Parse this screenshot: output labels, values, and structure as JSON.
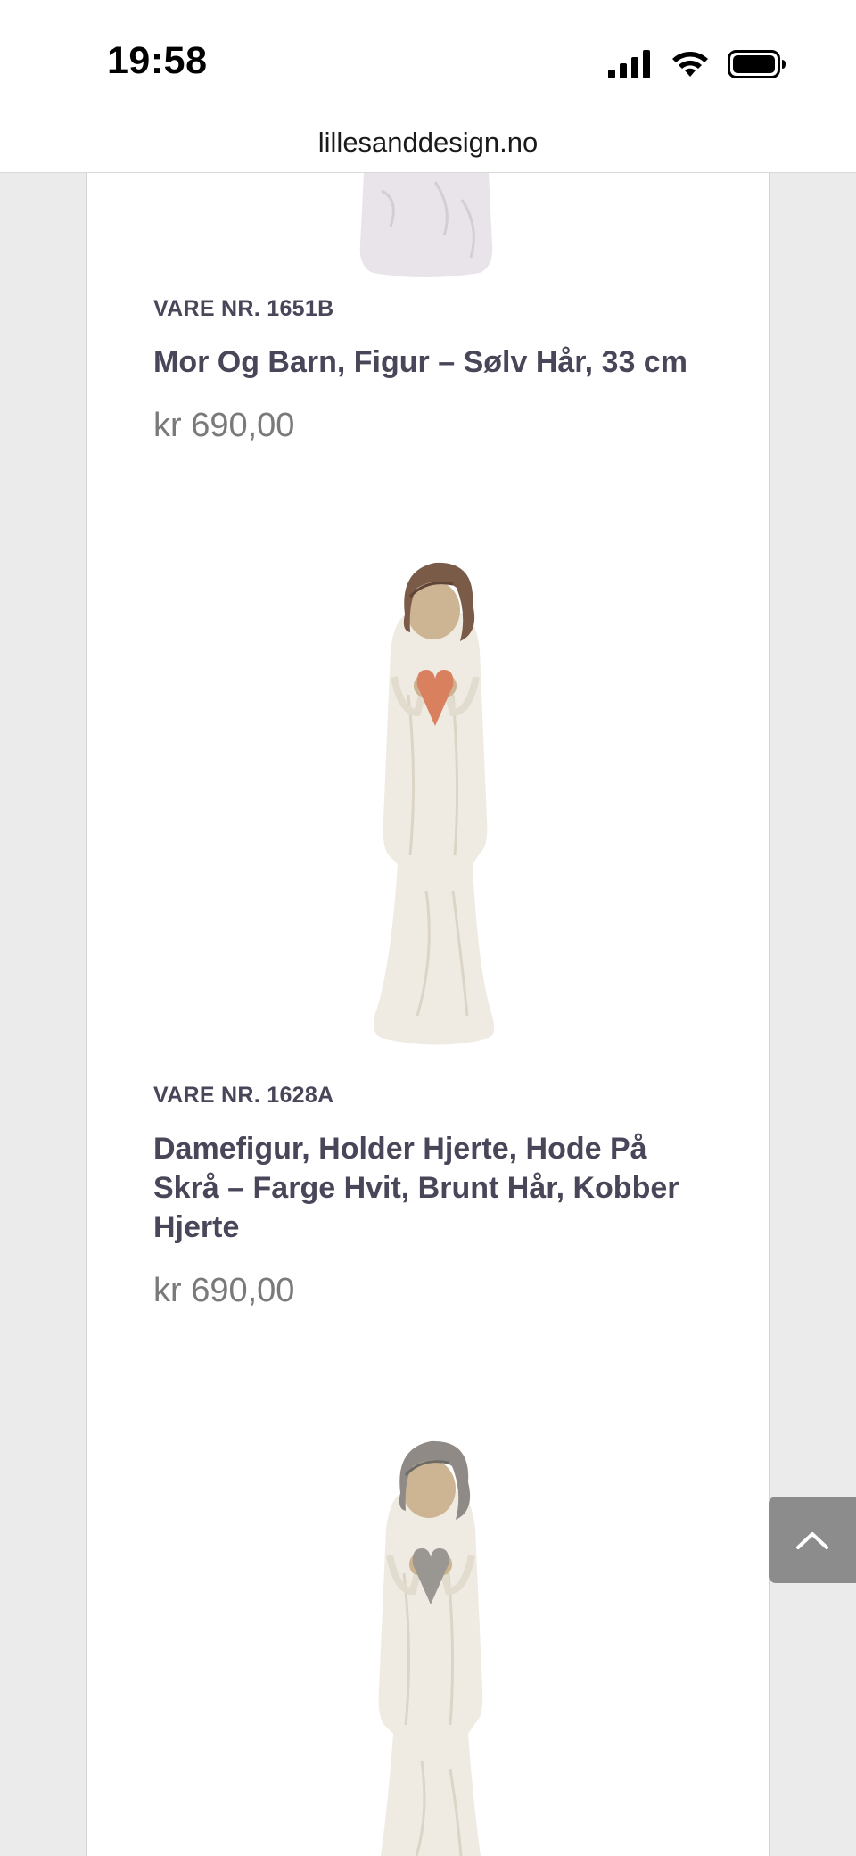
{
  "status_bar": {
    "time": "19:58"
  },
  "browser": {
    "url": "lillesanddesign.no"
  },
  "products": [
    {
      "sku": "VARE NR. 1651B",
      "name": "Mor Og Barn, Figur – Sølv Hår, 33 cm",
      "price": "kr 690,00"
    },
    {
      "sku": "VARE NR. 1628A",
      "name": "Damefigur, Holder Hjerte, Hode På Skrå – Farge Hvit, Brunt Hår, Kobber Hjerte",
      "price": "kr 690,00"
    }
  ],
  "colors": {
    "title": "#4a4659",
    "price": "#7a7a7a",
    "back_to_top_bg": "#8c8c8c",
    "hair_brown": "#7a5b48",
    "hair_silver": "#8f8a86",
    "heart_copper": "#d9805f",
    "heart_silver": "#9a9793",
    "figure_body": "#efebe2"
  },
  "icons": {
    "back_to_top": "chevron-up-icon"
  }
}
